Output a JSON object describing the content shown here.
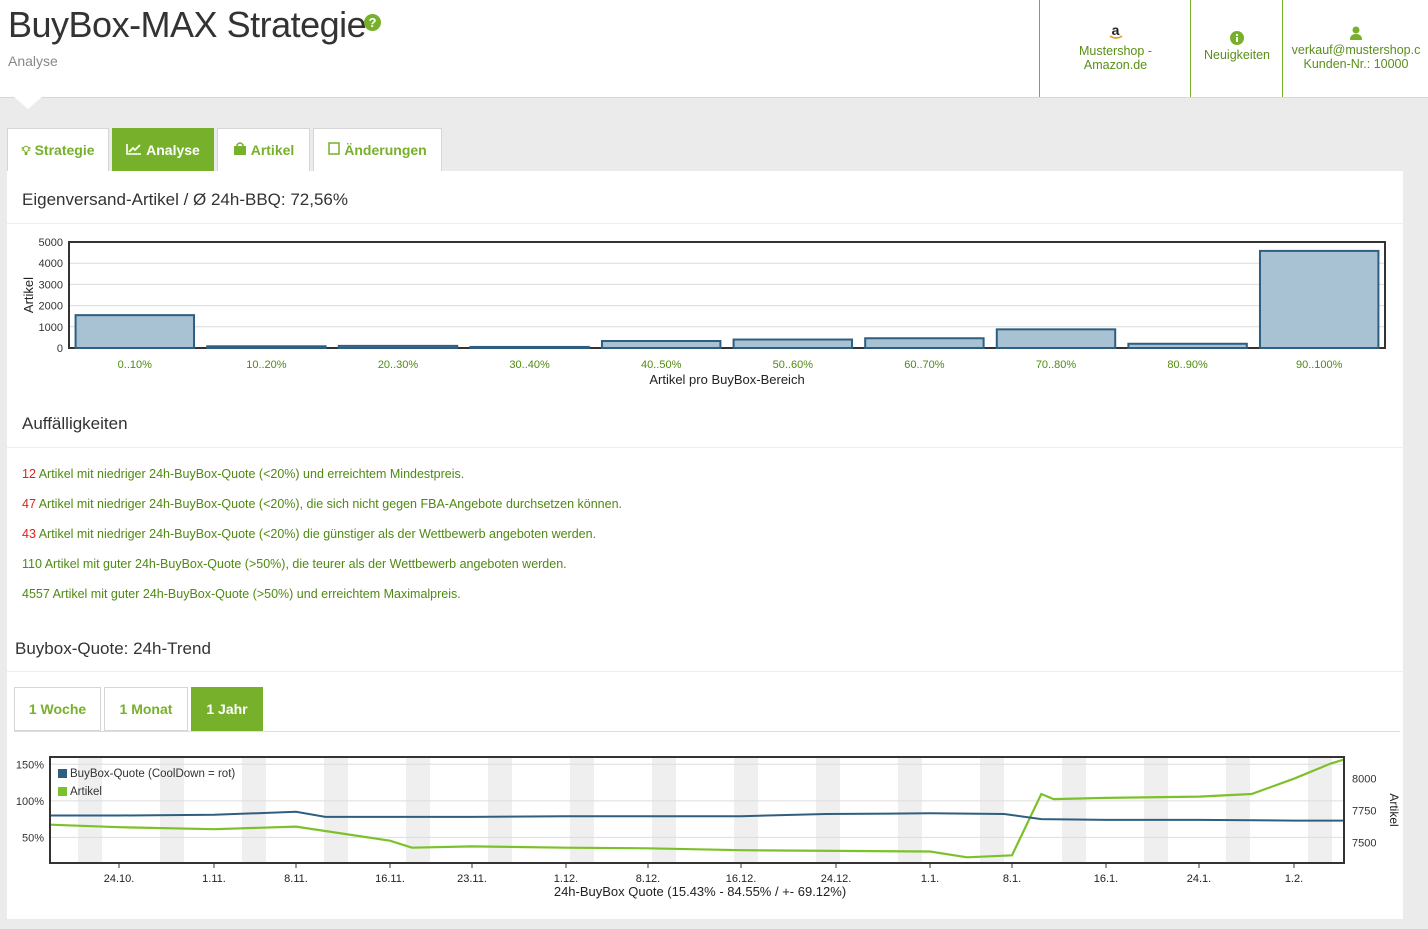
{
  "header": {
    "title": "BuyBox-MAX Strategie",
    "subtitle": "Analyse",
    "shop_line1": "Mustershop -",
    "shop_line2": "Amazon.de",
    "news_label": "Neuigkeiten",
    "account_email": "verkauf@mustershop.c",
    "account_customer": "Kunden-Nr.: 10000"
  },
  "tabs": [
    {
      "label": "Strategie",
      "icon": "lightbulb-icon"
    },
    {
      "label": "Analyse",
      "icon": "chart-line-icon",
      "active": true
    },
    {
      "label": "Artikel",
      "icon": "shopping-bag-icon"
    },
    {
      "label": "Änderungen",
      "icon": "document-icon"
    }
  ],
  "histogram_title": "Eigenversand-Artikel / Ø 24h-BBQ: 72,56%",
  "issues_title": "Auffälligkeiten",
  "issues": [
    {
      "count": "12",
      "text": " Artikel mit niedriger 24h-BuyBox-Quote (<20%) und erreichtem Mindestpreis.",
      "count_color": "#d9261c"
    },
    {
      "count": "47",
      "text": " Artikel mit niedriger 24h-BuyBox-Quote (<20%), die sich nicht gegen FBA-Angebote durchsetzen können.",
      "count_color": "#d9261c"
    },
    {
      "count": "43",
      "text": " Artikel mit niedriger 24h-BuyBox-Quote (<20%) die günstiger als der Wettbewerb angeboten werden.",
      "count_color": "#d9261c"
    },
    {
      "count": "110",
      "text": " Artikel mit guter 24h-BuyBox-Quote (>50%), die teurer als der Wettbewerb angeboten werden.",
      "count_color": "#4f8a10"
    },
    {
      "count": "4557",
      "text": " Artikel mit guter 24h-BuyBox-Quote (>50%) und erreichtem Maximalpreis.",
      "count_color": "#4f8a10"
    }
  ],
  "trend_title": "Buybox-Quote: 24h-Trend",
  "range_tabs": [
    {
      "label": "1 Woche"
    },
    {
      "label": "1 Monat"
    },
    {
      "label": "1 Jahr",
      "active": true
    }
  ],
  "colors": {
    "accent": "#77b02a",
    "bar_fill": "#a8c2d4",
    "bar_stroke": "#2e5f80",
    "line_blue": "#2e5f80",
    "line_green": "#7cc12a"
  },
  "chart_data": [
    {
      "type": "bar",
      "title": "",
      "xlabel": "Artikel pro BuyBox-Bereich",
      "ylabel": "Artikel",
      "categories": [
        "0..10%",
        "10..20%",
        "20..30%",
        "30..40%",
        "40..50%",
        "50..60%",
        "60..70%",
        "70..80%",
        "80..90%",
        "90..100%"
      ],
      "values": [
        1550,
        80,
        100,
        50,
        330,
        400,
        460,
        880,
        200,
        4580
      ],
      "ylim": [
        0,
        5000
      ],
      "yticks": [
        0,
        1000,
        2000,
        3000,
        4000,
        5000
      ],
      "grid": true
    },
    {
      "type": "line",
      "xlabel": "24h-BuyBox Quote (15.43% - 84.55% / +- 69.12%)",
      "x_ticks": [
        "24.10.",
        "1.11.",
        "8.11.",
        "16.11.",
        "23.11.",
        "1.12.",
        "8.12.",
        "16.12.",
        "24.12.",
        "1.1.",
        "8.1.",
        "16.1.",
        "24.1.",
        "1.2."
      ],
      "y_left_ticks": [
        "50%",
        "100%",
        "150%"
      ],
      "y_left_range": [
        15,
        160
      ],
      "y_right_label": "Artikel",
      "y_right_ticks": [
        7500,
        7750,
        8000
      ],
      "y_right_range": [
        7340,
        8170
      ],
      "legend_position": "top-left",
      "series": [
        {
          "name": "BuyBox-Quote (CoolDown = rot)",
          "axis": "left",
          "x": [
            "17.10.",
            "24.10.",
            "1.11.",
            "8.11.",
            "10.11.",
            "16.11.",
            "23.11.",
            "1.12.",
            "8.12.",
            "16.12.",
            "22.12.",
            "1.1.",
            "7.1.",
            "10.1.",
            "16.1.",
            "24.1.",
            "1.2.",
            "6.2."
          ],
          "values": [
            80,
            80,
            81,
            85,
            78,
            78,
            78,
            79,
            79,
            79,
            82,
            83,
            82,
            75,
            74,
            74,
            73,
            73
          ]
        },
        {
          "name": "Artikel",
          "axis": "right",
          "x": [
            "17.10.",
            "24.10.",
            "1.11.",
            "8.11.",
            "16.11.",
            "17.11.",
            "23.11.",
            "1.12.",
            "8.12.",
            "16.12.",
            "24.12.",
            "1.1.",
            "4.1.",
            "8.1.",
            "10.1.",
            "11.1.",
            "16.1.",
            "24.1.",
            "27.1.",
            "1.2.",
            "4.2.",
            "6.2."
          ],
          "values": [
            7640,
            7620,
            7605,
            7625,
            7515,
            7460,
            7470,
            7460,
            7455,
            7440,
            7435,
            7430,
            7385,
            7400,
            7880,
            7840,
            7850,
            7860,
            7880,
            8000,
            8120,
            8150
          ]
        }
      ]
    }
  ]
}
